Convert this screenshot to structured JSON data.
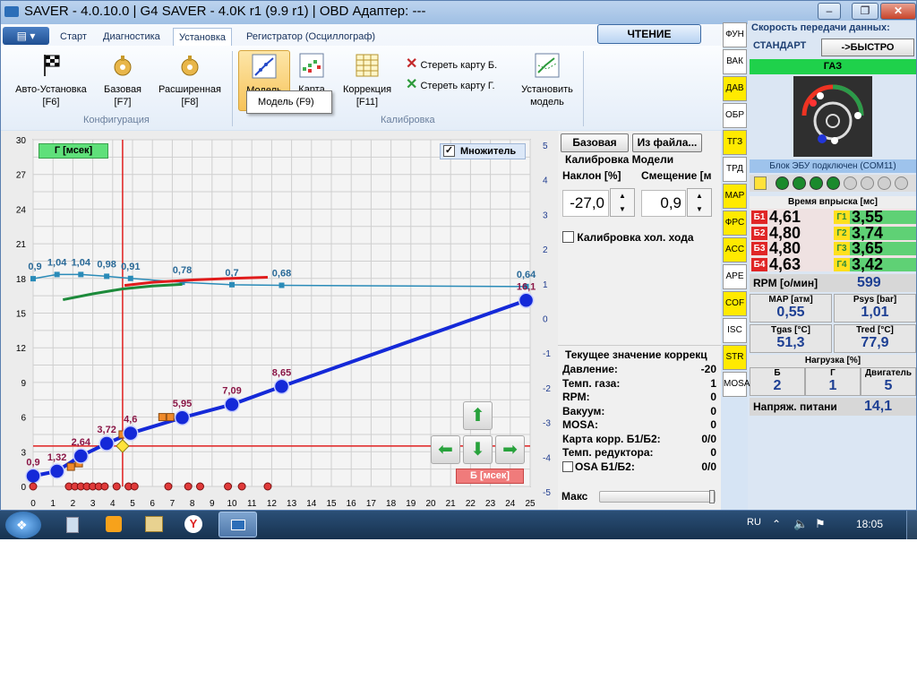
{
  "window": {
    "title": "SAVER - 4.0.10.0  |  G4 SAVER - 4.0K r1 (9.9 r1)  |  OBD Адаптер: ---",
    "minimize": "‒",
    "maximize": "❐",
    "close": "✕"
  },
  "ribbon": {
    "tabs": [
      "Старт",
      "Диагностика",
      "Установка",
      "Регистратор (Осциллограф)"
    ],
    "active_tab": "Установка",
    "read_button": "ЧТЕНИЕ",
    "config_buttons": [
      {
        "label": "Авто-Установка",
        "key": "[F6]",
        "icon": "checkered-flag-icon"
      },
      {
        "label": "Базовая",
        "key": "[F7]",
        "icon": "gear-icon"
      },
      {
        "label": "Расширенная",
        "key": "[F8]",
        "icon": "gear-icon"
      }
    ],
    "config_group": "Конфигурация",
    "calib_buttons": [
      {
        "label": "Модель",
        "icon": "model-chart-icon"
      },
      {
        "label": "Карта",
        "icon": "map-grid-icon"
      },
      {
        "label": "Коррекция",
        "key": "[F11]",
        "icon": "table-icon"
      }
    ],
    "clear_b": "Стереть карту Б.",
    "clear_g": "Стереть карту Г.",
    "install_model_1": "Установить",
    "install_model_2": "модель",
    "calib_group": "Калибровка",
    "tooltip": "Модель (F9)"
  },
  "chart_data": {
    "type": "line",
    "xlabel": "Б [мсек]",
    "ylabel": "Г [мсек]",
    "checkbox_label": "Множитель",
    "checkbox_checked": true,
    "xlim": [
      0,
      25
    ],
    "ylim": [
      0,
      30
    ],
    "y2lim": [
      -5,
      5
    ],
    "xticks": [
      0,
      1,
      2,
      3,
      4,
      5,
      6,
      7,
      8,
      9,
      10,
      11,
      12,
      13,
      14,
      15,
      16,
      17,
      18,
      19,
      20,
      21,
      22,
      23,
      24,
      25
    ],
    "yticks": [
      0,
      3,
      6,
      9,
      12,
      15,
      18,
      21,
      24,
      27,
      30
    ],
    "y2ticks": [
      5,
      4,
      3,
      2,
      1,
      0,
      -1,
      -2,
      -3,
      -4,
      -5
    ],
    "y2tick_labels": [
      "5",
      "4",
      "3",
      "2",
      "1",
      "0",
      "-1",
      "-2",
      "-3",
      "-4",
      "-5"
    ],
    "grid": true,
    "series": [
      {
        "x": [
          0,
          1.2,
          2.4,
          3.7,
          4.9,
          7.5,
          10,
          12.5,
          24.8
        ],
        "y": [
          0.9,
          1.32,
          2.64,
          3.72,
          4.6,
          5.95,
          7.09,
          8.65,
          16.1
        ],
        "labels": [
          "0,9",
          "1,32",
          "2,64",
          "3,72",
          "4,6",
          "5,95",
          "7,09",
          "8,65",
          "16,1"
        ]
      },
      {
        "x": [
          0,
          1.2,
          2.4,
          3.7,
          4.9,
          7.5,
          10,
          12.5,
          24.8
        ],
        "y": [
          0.9,
          1.04,
          1.04,
          0.98,
          0.91,
          0.78,
          0.7,
          0.68,
          0.64
        ],
        "labels": [
          "0,9",
          "1,04",
          "1,04",
          "0,98",
          "0,91",
          "0,78",
          "0,7",
          "0,68",
          "0,64"
        ]
      },
      {
        "x": [
          1.5,
          3,
          4.5,
          6,
          7.5
        ],
        "y": [
          0.2,
          0.48,
          0.72,
          0.86,
          0.94
        ]
      },
      {
        "x": [
          4.6,
          6,
          8,
          10,
          11.8
        ],
        "y": [
          0.7,
          0.86,
          0.98,
          1.06,
          1.12
        ]
      }
    ],
    "crosshair": {
      "x": 4.5,
      "y": 3.5
    },
    "cursor_point": {
      "x": 4.5,
      "y": 3.5
    }
  },
  "calib": {
    "base_button": "Базовая",
    "from_file_button": "Из файла...",
    "title": "Калибровка Модели",
    "slope_label": "Наклон [%]",
    "offset_label": "Смещение [м",
    "slope_value": "-27,0",
    "offset_value": "0,9",
    "idle_calib": "Калибровка хол. хода",
    "current_title": "Текущее значение коррекц",
    "rows": [
      {
        "label": "Давление:",
        "value": "-20"
      },
      {
        "label": "Темп. газа:",
        "value": "1"
      },
      {
        "label": "RPM:",
        "value": "0"
      },
      {
        "label": "Вакуум:",
        "value": "0"
      },
      {
        "label": "MOSA:",
        "value": "0"
      },
      {
        "label": "Карта корр. Б1/Б2:",
        "value": "0/0"
      },
      {
        "label": "Темп. редуктора:",
        "value": "0"
      },
      {
        "label": "OSA Б1/Б2:",
        "value": "0/0"
      }
    ],
    "max_label": "Макс"
  },
  "side_tabs": [
    "ФУН",
    "ВАК",
    "ДАВ",
    "ОБР",
    "ТГЗ",
    "ТРД",
    "MAP",
    "ФРС",
    "ACC",
    "APE",
    "COF",
    "ISC",
    "STR",
    "MOSA"
  ],
  "status": {
    "speed_title": "Скорость передачи данных:",
    "speed_std": "СТАНДАРТ",
    "speed_fast": "->БЫСТРО",
    "gas_label": "ГАЗ",
    "ecu": "Блок ЭБУ подключен (COM11)",
    "inj_title": "Время впрыска [мс]",
    "inj_b": [
      {
        "label": "Б1",
        "value": "4,61"
      },
      {
        "label": "Б2",
        "value": "4,80"
      },
      {
        "label": "Б3",
        "value": "4,80"
      },
      {
        "label": "Б4",
        "value": "4,63"
      }
    ],
    "inj_g": [
      {
        "label": "Г1",
        "value": "3,55"
      },
      {
        "label": "Г2",
        "value": "3,74"
      },
      {
        "label": "Г3",
        "value": "3,65"
      },
      {
        "label": "Г4",
        "value": "3,42"
      }
    ],
    "rpm_label": "RPM [о/мин]",
    "rpm_value": "599",
    "map_label": "MAP [атм]",
    "map_value": "0,55",
    "psys_label": "Psys [bar]",
    "psys_value": "1,01",
    "tgas_label": "Tgas [°C]",
    "tgas_value": "51,3",
    "tred_label": "Tred [°C]",
    "tred_value": "77,9",
    "load_title": "Нагрузка [%]",
    "load_b_label": "Б",
    "load_b": "2",
    "load_g_label": "Г",
    "load_g": "1",
    "load_engine_label": "Двигатель",
    "load_engine": "5",
    "voltage_label": "Напряж. питани",
    "voltage_value": "14,1"
  },
  "taskbar": {
    "lang": "RU",
    "time": "18:05"
  }
}
